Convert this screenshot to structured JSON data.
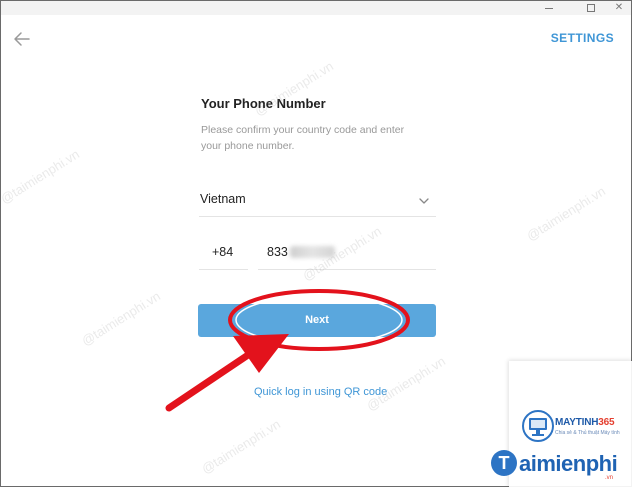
{
  "header": {
    "settings_label": "SETTINGS"
  },
  "form": {
    "title": "Your Phone Number",
    "description": "Please confirm your country code and enter your phone number.",
    "country": "Vietnam",
    "country_code": "+84",
    "phone_value": "833"
  },
  "actions": {
    "next_label": "Next",
    "qr_link": "Quick log in using QR code"
  },
  "watermark": {
    "maytinh_prefix": "MAYTINH",
    "maytinh_suffix": "365",
    "maytinh_tagline": "Chia sẻ & Thủ thuật Máy tính",
    "brand": "aimienphi",
    "brand_letter": "T",
    "brand_tld": ".vn",
    "wm_text": "@taimienphi.vn"
  },
  "colors": {
    "accent": "#5aa7dd",
    "link": "#3f96d6",
    "annotation": "#e3121c"
  },
  "icons": {
    "back": "arrow-left-icon",
    "dropdown": "chevron-down-icon"
  }
}
